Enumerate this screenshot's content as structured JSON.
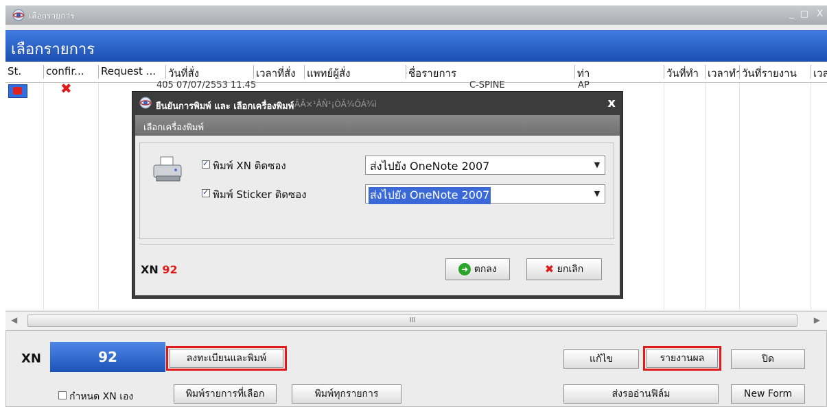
{
  "window": {
    "title": "เลือกรายการ",
    "controls": [
      "_",
      "□",
      "X"
    ]
  },
  "header": {
    "title": "เลือกรายการ"
  },
  "table": {
    "columns": [
      "St.",
      "confir...",
      "Request ...",
      "วันที่สั่ง",
      "เวลาที่สั่ง",
      "แพทย์ผู้สั่ง",
      "ชื่อรายการ",
      "ท่า",
      "วันที่ทำ",
      "เวลาทำ",
      "วันที่รายงาน",
      "เวล"
    ],
    "row": {
      "status_color": "#e02020",
      "confirm_icon": "red-x-icon",
      "ghost_text_1": "405 07/07/2553 11.45",
      "ghost_text_2": "C-SPINE",
      "ghost_text_3": "AP"
    }
  },
  "scrollbar": {
    "grip": "III",
    "left_arrow": "◀",
    "right_arrow": "▶"
  },
  "bottom": {
    "xn_label": "XN",
    "xn_value": "92",
    "register_print_label": "ลงทะเบียนและพิมพ์",
    "print_selected_label": "พิมพ์รายการที่เลือก",
    "print_all_label": "พิมพ์ทุกรายการ",
    "set_xn_label": "กำหนด XN เอง",
    "set_xn_checked": false,
    "edit_label": "แก้ไข",
    "report_label": "รายงานผล",
    "close_label": "ปิด",
    "send_film_label": "ส่งรออ่านฟิล์ม",
    "new_form_label": "New Form",
    "highlight_color": "#e01919"
  },
  "dialog": {
    "title": "ยืนยันการพิมพ์ และ เลือกเครื่องพิมพ์",
    "garbled_text": "ÂÃ×¹ÂÑ¹¡ÒÃ¾ÔÁ¾ì",
    "close": "x",
    "section": "เลือกเครื่องพิมพ์",
    "opt1_label": "พิมพ์ XN ติดซอง",
    "opt1_checked": true,
    "opt1_printer": "ส่งไปยัง OneNote 2007",
    "opt2_label": "พิมพ์ Sticker ติดซอง",
    "opt2_checked": true,
    "opt2_printer": "ส่งไปยัง OneNote 2007",
    "xn_label": "XN",
    "xn_value": "92",
    "ok_label": "ตกลง",
    "cancel_label": "ยกเลิก"
  }
}
